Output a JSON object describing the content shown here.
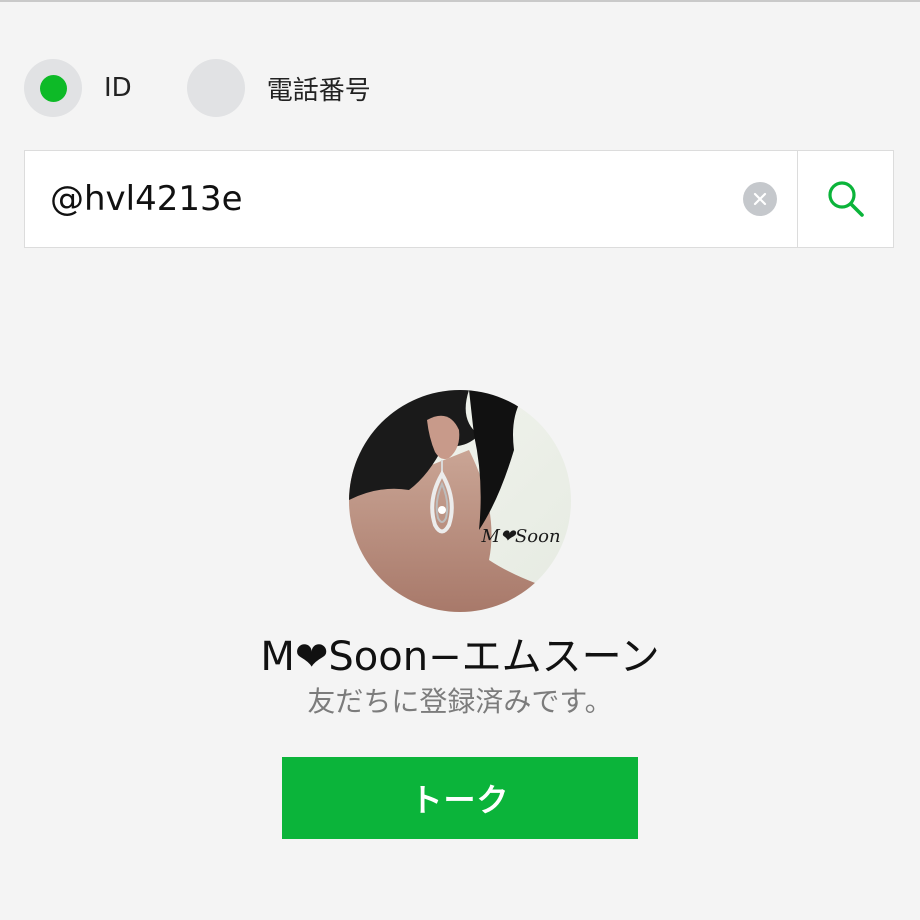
{
  "search_type": {
    "options": [
      {
        "label": "ID",
        "selected": true
      },
      {
        "label": "電話番号",
        "selected": false
      }
    ]
  },
  "search": {
    "value": "@hvl4213e",
    "clear_icon": "clear-x-icon",
    "search_icon": "magnifier-icon"
  },
  "result": {
    "avatar_watermark": "M❤Soon",
    "name": "M❤Soon−エムスーン",
    "status": "友だちに登録済みです。",
    "talk_button_label": "トーク"
  },
  "colors": {
    "accent": "#0bb43a",
    "selected_dot": "#0dba27",
    "background": "#f4f4f4"
  }
}
